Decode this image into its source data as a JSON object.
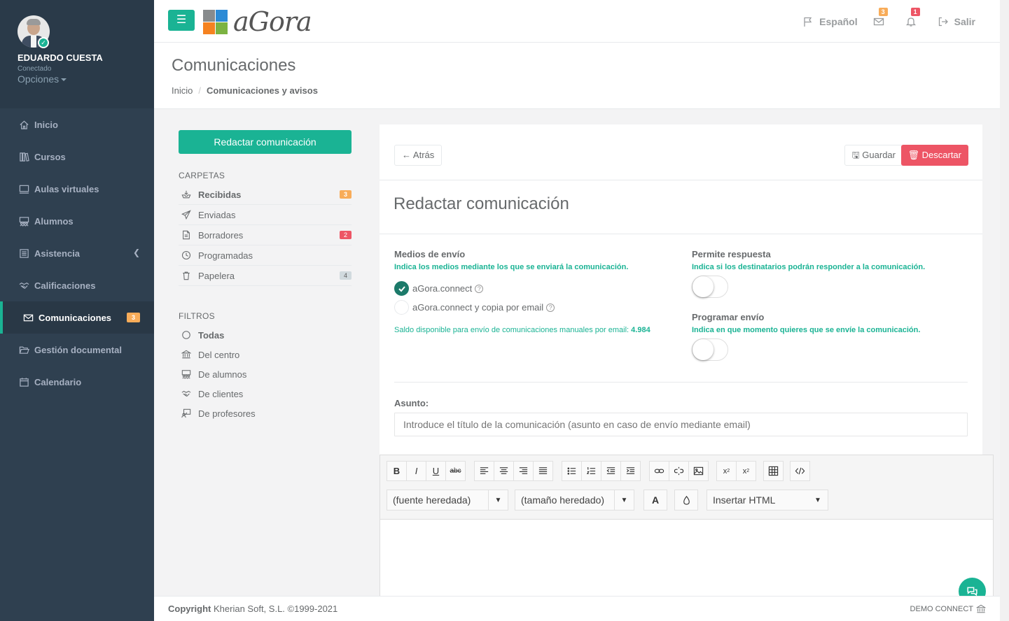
{
  "user": {
    "name": "EDUARDO CUESTA",
    "status": "Conectado",
    "options": "Opciones"
  },
  "nav": [
    {
      "label": "Inicio",
      "icon": "home-icon"
    },
    {
      "label": "Cursos",
      "icon": "books-icon"
    },
    {
      "label": "Aulas virtuales",
      "icon": "monitor-icon"
    },
    {
      "label": "Alumnos",
      "icon": "students-icon"
    },
    {
      "label": "Asistencia",
      "icon": "list-icon"
    },
    {
      "label": "Calificaciones",
      "icon": "handshake-icon"
    },
    {
      "label": "Comunicaciones",
      "icon": "envelope-icon",
      "badge": "3"
    },
    {
      "label": "Gestión documental",
      "icon": "folder-icon"
    },
    {
      "label": "Calendario",
      "icon": "calendar-icon"
    }
  ],
  "topbar": {
    "brand": "aGora",
    "language": "Español",
    "mail_count": "3",
    "bell_count": "1",
    "logout": "Salir"
  },
  "heading": {
    "title": "Comunicaciones",
    "crumb_home": "Inicio",
    "crumb_current": "Comunicaciones y avisos"
  },
  "mail": {
    "compose": "Redactar comunicación",
    "folders_title": "CARPETAS",
    "folders": [
      {
        "label": "Recibidas",
        "badge": "3"
      },
      {
        "label": "Enviadas"
      },
      {
        "label": "Borradores",
        "badge": "2"
      },
      {
        "label": "Programadas"
      },
      {
        "label": "Papelera",
        "badge": "4"
      }
    ],
    "filters_title": "FILTROS",
    "filters": [
      {
        "label": "Todas"
      },
      {
        "label": "Del centro"
      },
      {
        "label": "De alumnos"
      },
      {
        "label": "De clientes"
      },
      {
        "label": "De profesores"
      }
    ]
  },
  "panel": {
    "back": "Atrás",
    "save": "Guardar",
    "discard": "Descartar",
    "title": "Redactar comunicación",
    "medios_title": "Medios de envío",
    "medios_hint": "Indica los medios mediante los que se enviará la comunicación.",
    "option1": "aGora.connect",
    "option2": "aGora.connect y copia por email",
    "saldo_text": "Saldo disponible para envío de comunicaciones manuales por email:",
    "saldo_value": "4.984",
    "respuesta_title": "Permite respuesta",
    "respuesta_hint": "Indica si los destinatarios podrán responder a la comunicación.",
    "programar_title": "Programar envío",
    "programar_hint": "Indica en que momento quieres que se envíe la comunicación.",
    "asunto_label": "Asunto:",
    "asunto_placeholder": "Introduce el título de la comunicación (asunto en caso de envío mediante email)"
  },
  "editor": {
    "font": "(fuente heredada)",
    "size": "(tamaño heredado)",
    "insert_html": "Insertar HTML",
    "bold": "B",
    "italic": "I",
    "underline": "U",
    "strike": "abc"
  },
  "footer": {
    "copyright_bold": "Copyright",
    "copyright": "Kherian Soft, S.L. ©1999-2021",
    "right": "DEMO CONNECT"
  },
  "colors": {
    "sidebar": "#2f4050",
    "accent": "#1ab394",
    "danger": "#ed5565",
    "warning": "#f8ac59"
  }
}
